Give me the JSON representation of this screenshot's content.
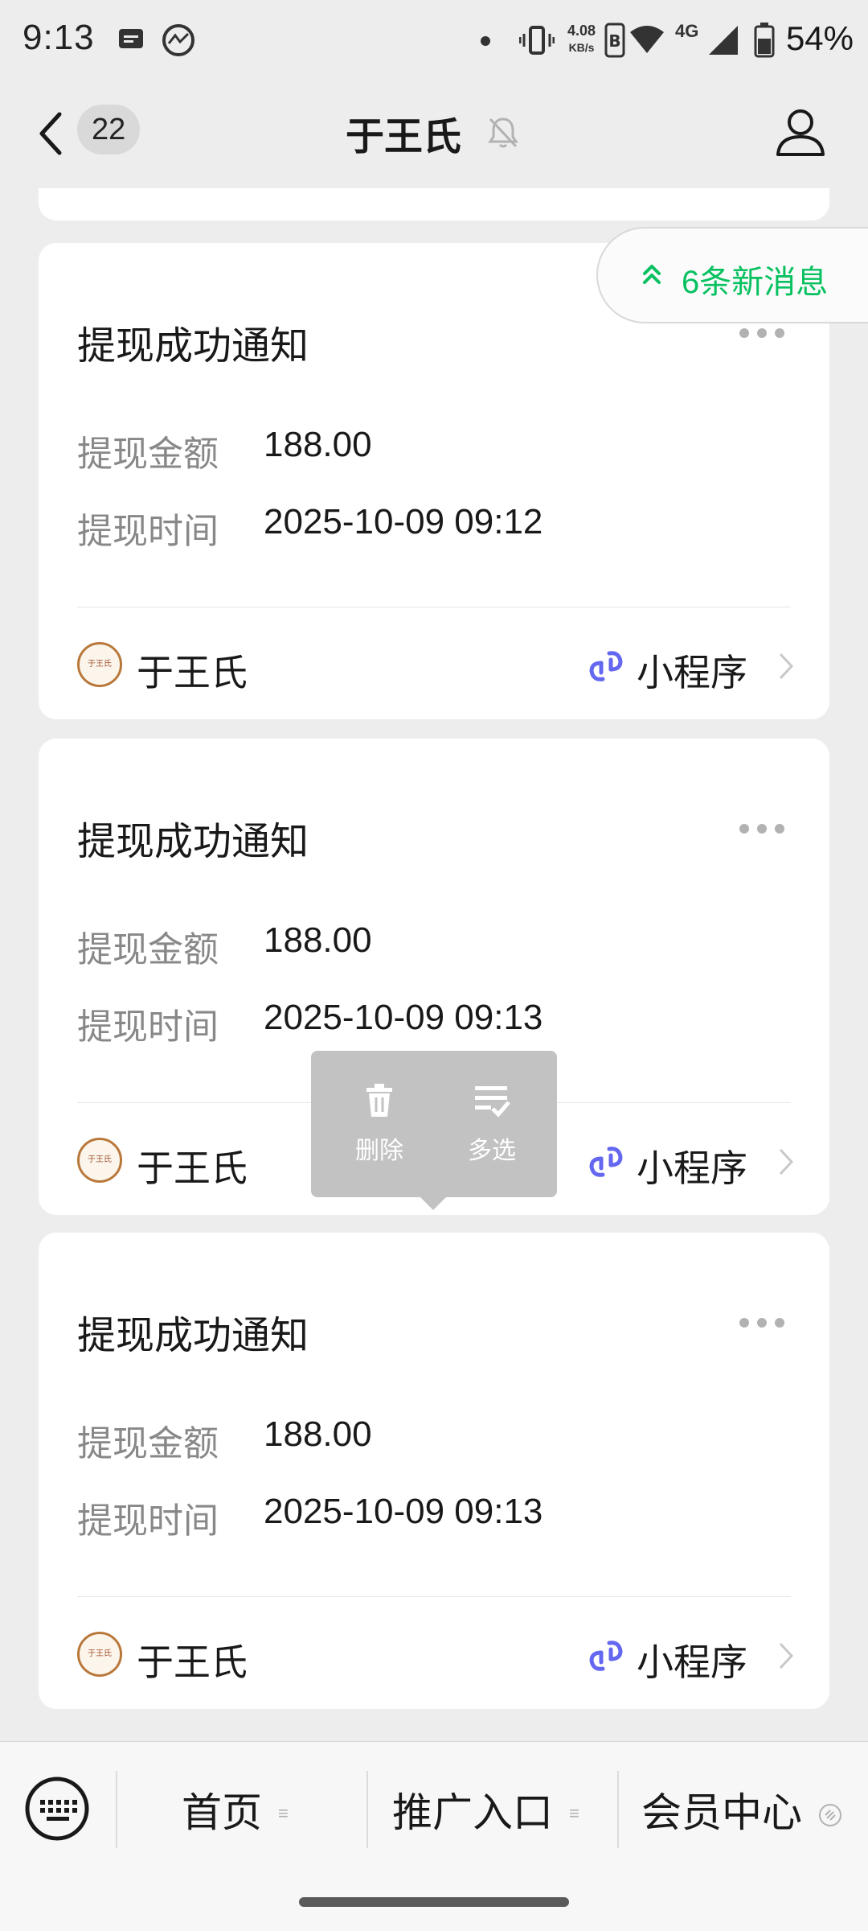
{
  "status_bar": {
    "time": "9:13",
    "net_speed_value": "4.08",
    "net_speed_unit": "KB/s",
    "network_type": "4G",
    "battery": "54%"
  },
  "header": {
    "unread_count": "22",
    "title": "于王氏"
  },
  "new_messages": {
    "label": "6条新消息",
    "accent": "#07c160"
  },
  "cards": [
    {
      "title": "提现成功通知",
      "amount_label": "提现金额",
      "amount": "188.00",
      "time_label": "提现时间",
      "time": "2025-10-09 09:12",
      "source_name": "于王氏",
      "link_label": "小程序"
    },
    {
      "title": "提现成功通知",
      "amount_label": "提现金额",
      "amount": "188.00",
      "time_label": "提现时间",
      "time": "2025-10-09 09:13",
      "source_name": "于王氏",
      "link_label": "小程序"
    },
    {
      "title": "提现成功通知",
      "amount_label": "提现金额",
      "amount": "188.00",
      "time_label": "提现时间",
      "time": "2025-10-09 09:13",
      "source_name": "于王氏",
      "link_label": "小程序"
    }
  ],
  "popup": {
    "delete_label": "删除",
    "multiselect_label": "多选"
  },
  "bottom_menu": {
    "items": [
      "首页",
      "推广入口",
      "会员中心"
    ]
  },
  "avatar_text": "于王氏"
}
